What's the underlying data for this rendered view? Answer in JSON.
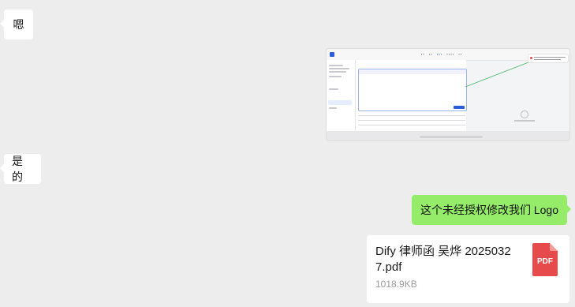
{
  "messages": [
    {
      "id": "m1",
      "side": "left",
      "type": "text",
      "text": "嗯"
    },
    {
      "id": "m2",
      "side": "right",
      "type": "image",
      "description": "screenshot"
    },
    {
      "id": "m3",
      "side": "left",
      "type": "text",
      "text": "是的"
    },
    {
      "id": "m4",
      "side": "right",
      "type": "text",
      "text": "这个未经授权修改我们 Logo"
    },
    {
      "id": "m5",
      "side": "right",
      "type": "file"
    }
  ],
  "file": {
    "name": "Dify 律师函 吴烨 20250327.pdf",
    "size": "1018.9KB",
    "type_label": "PDF"
  },
  "colors": {
    "background": "#ededed",
    "bubble_left": "#ffffff",
    "bubble_right": "#95ec69",
    "pdf_icon": "#e64a4a"
  }
}
